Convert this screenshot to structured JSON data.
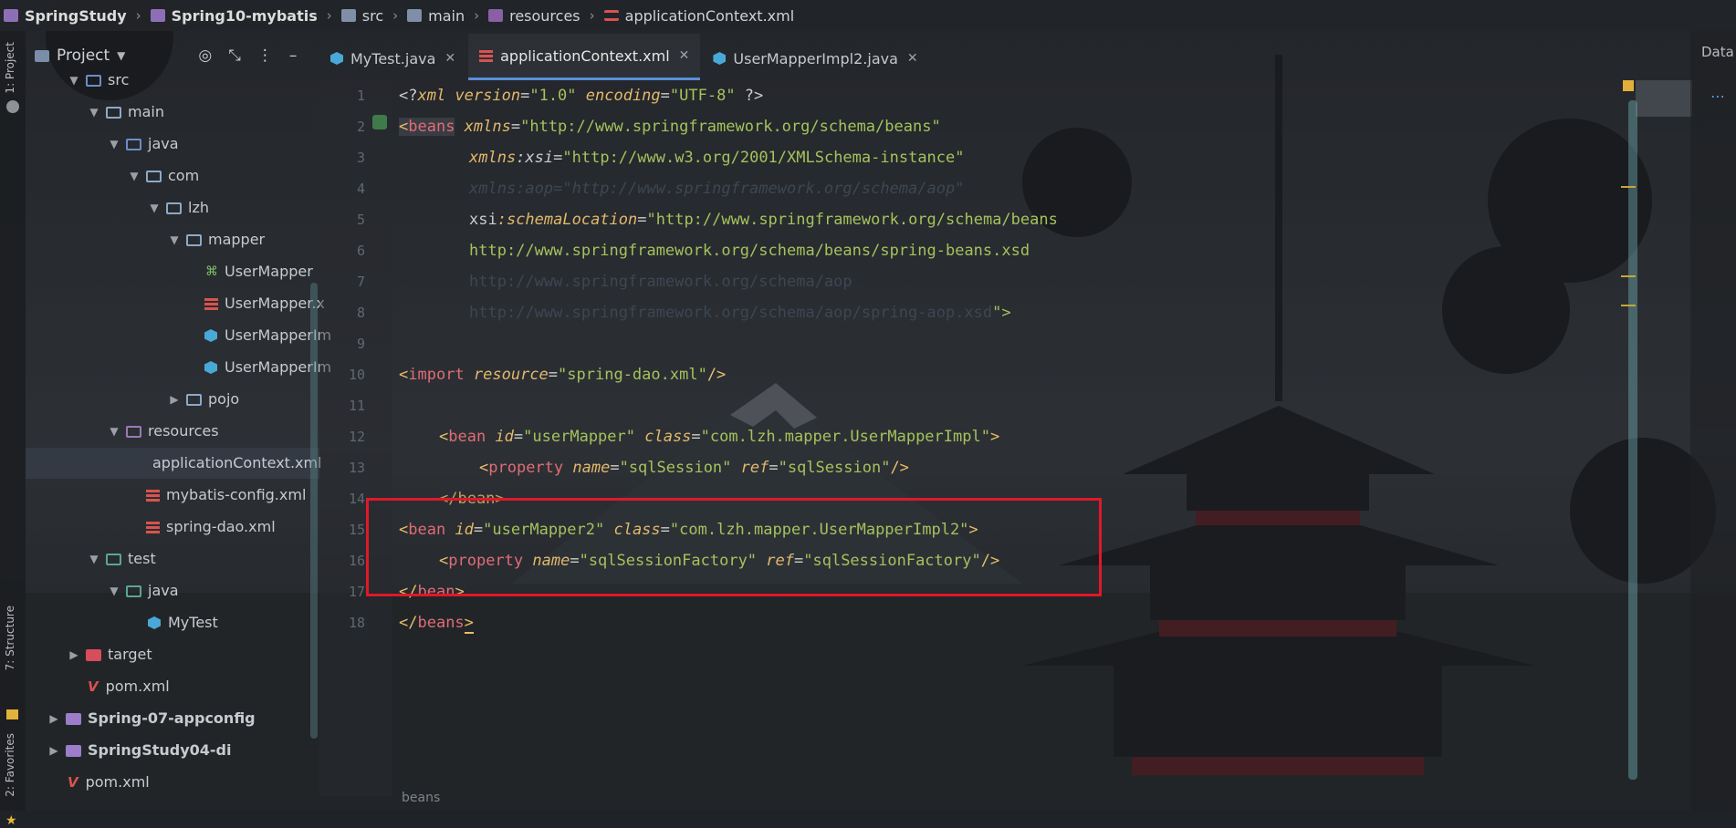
{
  "breadcrumb": {
    "items": [
      "SpringStudy",
      "Spring10-mybatis",
      "src",
      "main",
      "resources",
      "applicationContext.xml"
    ]
  },
  "left_strip": {
    "project": "1: Project",
    "structure": "7: Structure",
    "favorites": "2: Favorites"
  },
  "project_panel": {
    "title": "Project"
  },
  "tree": [
    {
      "label": "src"
    },
    {
      "label": "main"
    },
    {
      "label": "java"
    },
    {
      "label": "com"
    },
    {
      "label": "lzh"
    },
    {
      "label": "mapper"
    },
    {
      "label": "UserMapper"
    },
    {
      "label": "UserMapper.x"
    },
    {
      "label": "UserMapperIm"
    },
    {
      "label": "UserMapperIm"
    },
    {
      "label": "pojo"
    },
    {
      "label": "resources"
    },
    {
      "label": "applicationContext.xml"
    },
    {
      "label": "mybatis-config.xml"
    },
    {
      "label": "spring-dao.xml"
    },
    {
      "label": "test"
    },
    {
      "label": "java"
    },
    {
      "label": "MyTest"
    },
    {
      "label": "target"
    },
    {
      "label": "pom.xml"
    },
    {
      "label": "Spring-07-appconfig"
    },
    {
      "label": "SpringStudy04-di"
    },
    {
      "label": "pom.xml"
    }
  ],
  "tabs": [
    {
      "label": "MyTest.java"
    },
    {
      "label": "applicationContext.xml"
    },
    {
      "label": "UserMapperImpl2.java"
    }
  ],
  "right_strip": {
    "label": "Data"
  },
  "line_numbers": [
    "1",
    "2",
    "3",
    "4",
    "5",
    "6",
    "7",
    "8",
    "9",
    "10",
    "11",
    "12",
    "13",
    "14",
    "15",
    "16",
    "17",
    "18"
  ],
  "code": {
    "l1": {
      "a": "<?",
      "b": "xml ",
      "c": "version",
      "d": "=",
      "e": "\"1.0\"",
      "f": " encoding",
      "g": "=",
      "h": "\"UTF-8\"",
      "i": " ?>"
    },
    "l2": {
      "a": "<",
      "b": "beans",
      "c": " xmlns",
      "d": "=",
      "e": "\"http://www.springframework.org/schema/beans\""
    },
    "l3": {
      "a": "xmlns",
      "b": ":xsi",
      "c": "=",
      "d": "\"http://www.w3.org/2001/XMLSchema-instance\""
    },
    "l4": {
      "a": "xmlns:aop=\"http://www.springframework.org/schema/aop\""
    },
    "l5": {
      "a": "xsi",
      "b": ":schemaLocation",
      "c": "=",
      "d": "\"http://www.springframework.org/schema/beans"
    },
    "l6": {
      "a": "http://www.springframework.org/schema/beans/spring-beans.xsd"
    },
    "l7": {
      "a": "http://www.springframework.org/schema/aop"
    },
    "l8": {
      "a": "http://www.springframework.org/schema/aop/spring-aop.xsd",
      "b": "\">"
    },
    "l10": {
      "a": "<",
      "b": "import",
      "c": " resource",
      "d": "=",
      "e": "\"spring-dao.xml\"",
      "f": "/>"
    },
    "l12": {
      "a": "<",
      "b": "bean",
      "c": " id",
      "d": "=",
      "e": "\"userMapper\"",
      "f": " class",
      "g": "=",
      "h": "\"com.lzh.mapper.UserMapperImpl\"",
      "i": ">"
    },
    "l13": {
      "a": "<",
      "b": "property",
      "c": " name",
      "d": "=",
      "e": "\"sqlSession\"",
      "f": " ref",
      "g": "=",
      "h": "\"sqlSession\"",
      "i": "/>"
    },
    "l14": {
      "a": "</bean>"
    },
    "l15": {
      "a": "<",
      "b": "bean",
      "c": " id",
      "d": "=",
      "e": "\"userMapper2\"",
      "f": " class",
      "g": "=",
      "h": "\"com.lzh.mapper.UserMapperImpl2\"",
      "i": ">"
    },
    "l16": {
      "a": "<",
      "b": "property",
      "c": " name",
      "d": "=",
      "e": "\"sqlSessionFactory\"",
      "f": " ref",
      "g": "=",
      "h": "\"sqlSessionFactory\"",
      "i": "/>"
    },
    "l17": {
      "a": "</",
      "b": "bean",
      "c": ">"
    },
    "l18": {
      "a": "</",
      "b": "beans",
      "c": ">"
    }
  },
  "status_crumb": "beans"
}
